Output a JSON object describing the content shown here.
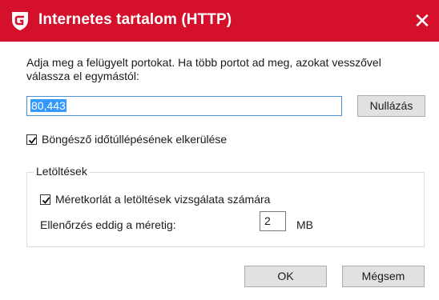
{
  "window": {
    "title": "Internetes tartalom (HTTP)",
    "close_symbol": "✕",
    "logo_icon": "gdata-shield-icon",
    "accent_color": "#d5102a"
  },
  "ports": {
    "description": "Adja meg a felügyelt portokat. Ha több portot ad meg, azokat vesszővel válassza el egymástól:",
    "value": "80,443",
    "reset_label": "Nullázás"
  },
  "timeout_checkbox": {
    "label": "Böngésző időtúllépésének elkerülése",
    "checked": true
  },
  "downloads": {
    "group_label": "Letöltések",
    "size_limit_checkbox": {
      "label": "Méretkorlát a letöltések vizsgálata számára",
      "checked": true
    },
    "check_until_label": "Ellenőrzés eddig a méretig:",
    "size_value": "2",
    "unit": "MB"
  },
  "buttons": {
    "ok": "OK",
    "cancel": "Mégsem"
  }
}
